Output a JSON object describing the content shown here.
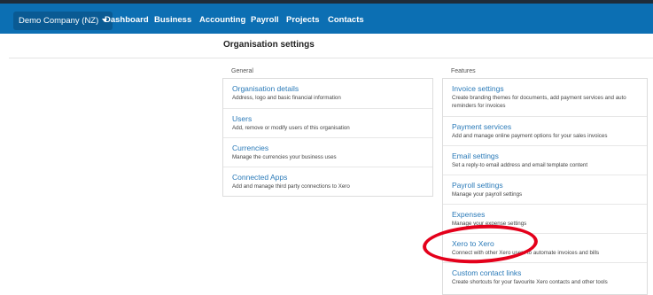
{
  "topbar": {
    "org_name": "Demo Company (NZ)",
    "nav": [
      "Dashboard",
      "Business",
      "Accounting",
      "Payroll",
      "Projects",
      "Contacts"
    ]
  },
  "page": {
    "title": "Organisation settings"
  },
  "general": {
    "label": "General",
    "items": [
      {
        "title": "Organisation details",
        "desc": "Address, logo and basic financial information"
      },
      {
        "title": "Users",
        "desc": "Add, remove or modify users of this organisation"
      },
      {
        "title": "Currencies",
        "desc": "Manage the currencies your business uses"
      },
      {
        "title": "Connected Apps",
        "desc": "Add and manage third party connections to Xero"
      }
    ]
  },
  "features": {
    "label": "Features",
    "items": [
      {
        "title": "Invoice settings",
        "desc": "Create branding themes for documents, add payment services and auto reminders for invoices"
      },
      {
        "title": "Payment services",
        "desc": "Add and manage online payment options for your sales invoices"
      },
      {
        "title": "Email settings",
        "desc": "Set a reply-to email address and email template content"
      },
      {
        "title": "Payroll settings",
        "desc": "Manage your payroll settings"
      },
      {
        "title": "Expenses",
        "desc": "Manage your expense settings"
      },
      {
        "title": "Xero to Xero",
        "desc": "Connect with other Xero users to automate invoices and bills"
      },
      {
        "title": "Custom contact links",
        "desc": "Create shortcuts for your favourite Xero contacts and other tools"
      }
    ]
  },
  "colors": {
    "topbar": "#0c6fb3",
    "link": "#2a7ab8",
    "annotation": "#e4001b"
  }
}
